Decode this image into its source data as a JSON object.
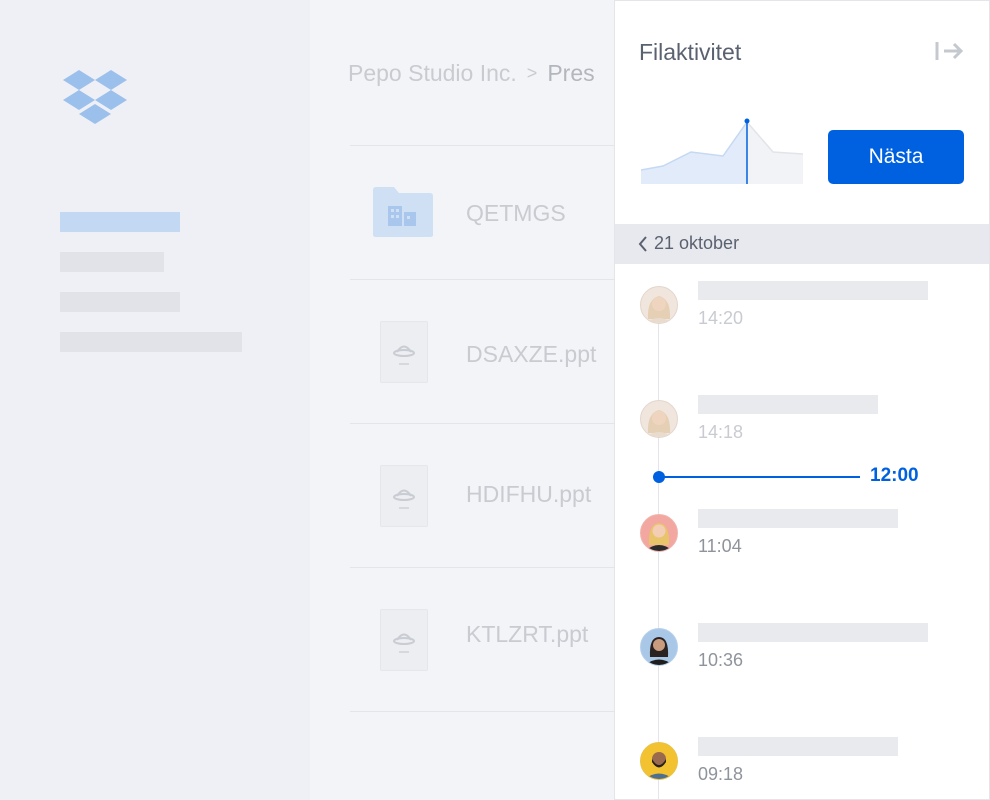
{
  "sidebar": {
    "logo": "dropbox-logo",
    "nav_items": [
      {
        "state": "active"
      },
      {
        "state": "inactive"
      },
      {
        "state": "inactive"
      },
      {
        "state": "inactive"
      }
    ]
  },
  "breadcrumb": {
    "parent": "Pepo Studio Inc.",
    "separator": ">",
    "current": "Pres"
  },
  "files": [
    {
      "name": "QETMGS",
      "type": "folder",
      "icon": "shared-folder-icon"
    },
    {
      "name": "DSAXZE.ppt",
      "type": "ppt",
      "icon": "presentation-file-icon"
    },
    {
      "name": "HDIFHU.ppt",
      "type": "ppt",
      "icon": "presentation-file-icon"
    },
    {
      "name": "KTLZRT.ppt",
      "type": "ppt",
      "icon": "presentation-file-icon"
    }
  ],
  "activity_panel": {
    "title": "Filaktivitet",
    "collapse_icon": "collapse-panel-icon",
    "next_button": "Nästa",
    "date_label": "21 oktober",
    "chart_color": "#0061e0",
    "current_time": "12:00",
    "entries": [
      {
        "time": "14:20",
        "avatar": "avatar-woman-blonde",
        "future": true
      },
      {
        "time": "14:18",
        "avatar": "avatar-woman-blonde",
        "future": true
      },
      {
        "time": "11:04",
        "avatar": "avatar-woman-red-bg",
        "future": false
      },
      {
        "time": "10:36",
        "avatar": "avatar-woman-blue-bg",
        "future": false
      },
      {
        "time": "09:18",
        "avatar": "avatar-man-yellow-bg",
        "future": false
      }
    ]
  }
}
